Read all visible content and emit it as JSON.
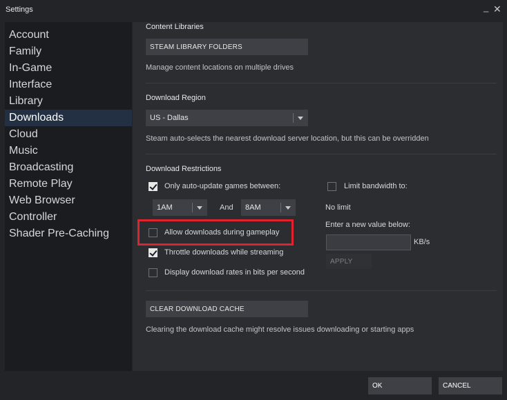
{
  "window": {
    "title": "Settings",
    "minimize_glyph": "_",
    "close_glyph": "✕"
  },
  "sidebar": {
    "items": [
      {
        "label": "Account"
      },
      {
        "label": "Family"
      },
      {
        "label": "In-Game"
      },
      {
        "label": "Interface"
      },
      {
        "label": "Library"
      },
      {
        "label": "Downloads",
        "active": true
      },
      {
        "label": "Cloud"
      },
      {
        "label": "Music"
      },
      {
        "label": "Broadcasting"
      },
      {
        "label": "Remote Play"
      },
      {
        "label": "Web Browser"
      },
      {
        "label": "Controller"
      },
      {
        "label": "Shader Pre-Caching"
      }
    ]
  },
  "content_libraries": {
    "heading": "Content Libraries",
    "button": "STEAM LIBRARY FOLDERS",
    "description": "Manage content locations on multiple drives"
  },
  "download_region": {
    "heading": "Download Region",
    "selected": "US - Dallas",
    "description": "Steam auto-selects the nearest download server location, but this can be overridden"
  },
  "download_restrictions": {
    "heading": "Download Restrictions",
    "auto_update": {
      "label": "Only auto-update games between:",
      "checked": true
    },
    "from_time": "1AM",
    "and_label": "And",
    "to_time": "8AM",
    "allow_during_gameplay": {
      "label": "Allow downloads during gameplay",
      "checked": false
    },
    "throttle_streaming": {
      "label": "Throttle downloads while streaming",
      "checked": true
    },
    "bits_per_second": {
      "label": "Display download rates in bits per second",
      "checked": false
    },
    "limit_bandwidth": {
      "label": "Limit bandwidth to:",
      "checked": false
    },
    "no_limit": "No limit",
    "enter_value": "Enter a new value below:",
    "input_value": "",
    "unit": "KB/s",
    "apply": "APPLY"
  },
  "cache": {
    "button": "CLEAR DOWNLOAD CACHE",
    "description": "Clearing the download cache might resolve issues downloading or starting apps"
  },
  "footer": {
    "ok": "OK",
    "cancel": "CANCEL"
  },
  "colors": {
    "active_nav": "#233043",
    "highlight": "#e0242f",
    "panel": "#2b2d31",
    "sidebar": "#1b1c1f"
  }
}
